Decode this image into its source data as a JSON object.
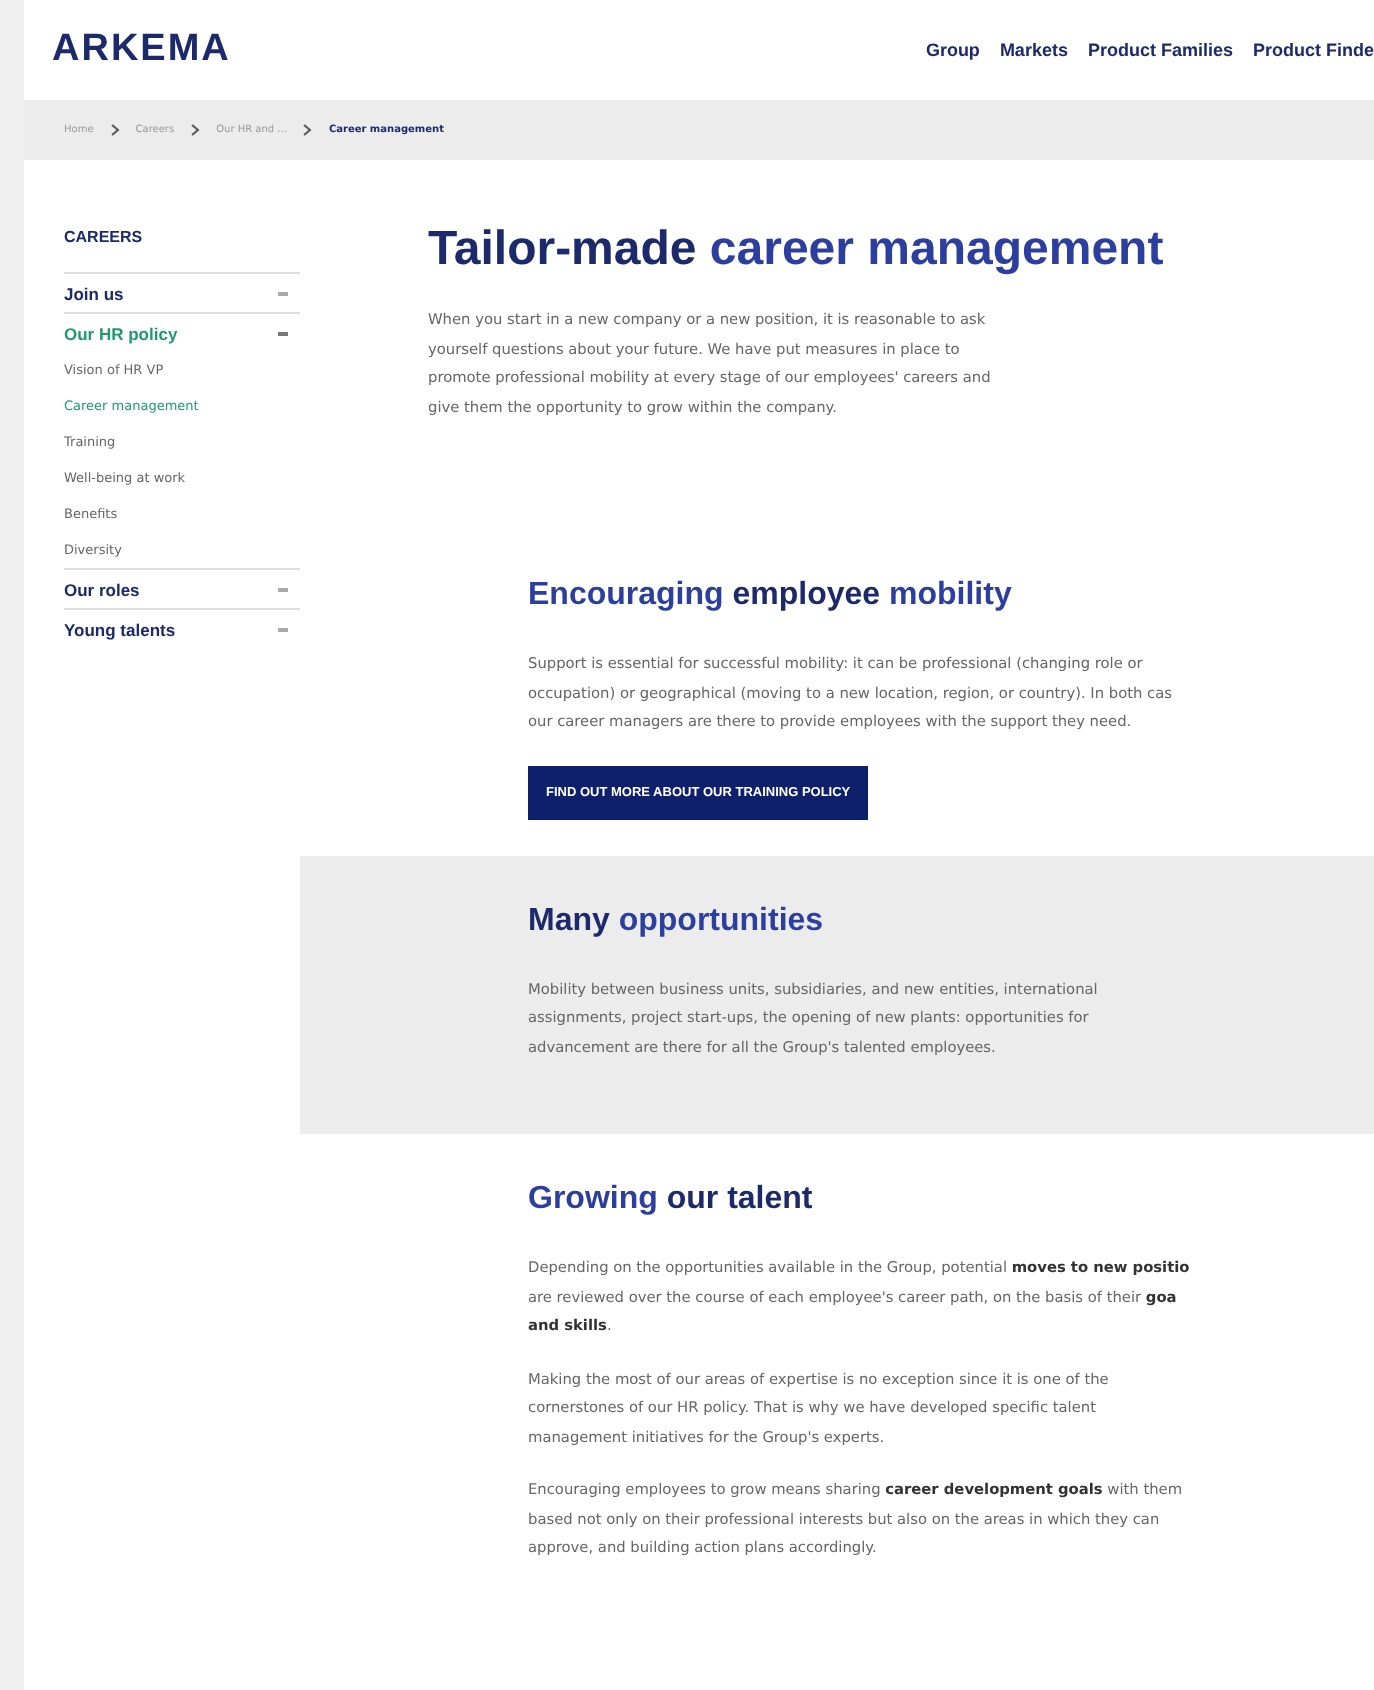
{
  "header": {
    "logo": "ARKEMA",
    "nav": [
      "Group",
      "Markets",
      "Product Families",
      "Product Finde"
    ]
  },
  "breadcrumb": [
    "Home",
    "Careers",
    "Our HR and ...",
    "Career management"
  ],
  "sidebar": {
    "title": "CAREERS",
    "items": [
      {
        "kind": "group",
        "label": "Join us",
        "expanded": false,
        "selected": false
      },
      {
        "kind": "group",
        "label": "Our HR policy",
        "expanded": true,
        "selected": true
      },
      {
        "kind": "link",
        "label": "Vision of HR VP",
        "selected": false
      },
      {
        "kind": "link",
        "label": "Career management",
        "selected": true
      },
      {
        "kind": "link",
        "label": "Training",
        "selected": false
      },
      {
        "kind": "link",
        "label": "Well-being at work",
        "selected": false
      },
      {
        "kind": "link",
        "label": "Benefits",
        "selected": false
      },
      {
        "kind": "link",
        "label": "Diversity",
        "selected": false
      },
      {
        "kind": "group",
        "label": "Our roles",
        "expanded": false,
        "selected": false
      },
      {
        "kind": "group",
        "label": "Young talents",
        "expanded": false,
        "selected": false
      }
    ]
  },
  "intro": {
    "title": [
      {
        "text": "Tailor-made",
        "accent": false
      },
      {
        "text": "career management",
        "accent": true
      }
    ],
    "text": "When you start in a new company or a new position, it is reasonable to ask\nyourself questions about your future. We have put measures in place to\npromote professional mobility at every stage of our employees' careers and\ngive them the opportunity to grow within the company."
  },
  "sections": [
    {
      "shaded": false,
      "title": [
        {
          "text": "Encouraging",
          "accent": true
        },
        {
          "text": "employee",
          "accent": false
        },
        {
          "text": "mobility",
          "accent": true
        }
      ],
      "paragraphs": [
        "Support is essential for successful mobility: it can be professional (changing role or\noccupation) or geographical (moving to a new location, region, or country). In both cas\nour career managers are there to provide employees with the support they need."
      ],
      "button": "FIND OUT MORE ABOUT OUR TRAINING POLICY"
    },
    {
      "shaded": true,
      "title": [
        {
          "text": "Many",
          "accent": false
        },
        {
          "text": "opportunities",
          "accent": true
        }
      ],
      "paragraphs": [
        "Mobility between business units, subsidiaries, and new entities, international\nassignments, project start-ups, the opening of new plants: opportunities for\nadvancement are there for all the Group's talented employees."
      ]
    },
    {
      "shaded": false,
      "title": [
        {
          "text": "Growing",
          "accent": true
        },
        {
          "text": "our talent",
          "accent": false
        }
      ],
      "paragraphs": [
        "Depending on the opportunities available in the Group, potential **moves to new positio**\nare reviewed over the course of each employee's career path, on the basis of their **goa**\n**and skills**.",
        "Making the most of our areas of expertise is no exception since it is one of the\ncornerstones of our HR policy. That is why we have developed specific talent\nmanagement initiatives for the Group's experts.",
        "Encouraging employees to grow means sharing **career development goals** with them\nbased not only on their professional interests but also on the areas in which they can\napprove, and building action plans accordingly."
      ]
    }
  ]
}
